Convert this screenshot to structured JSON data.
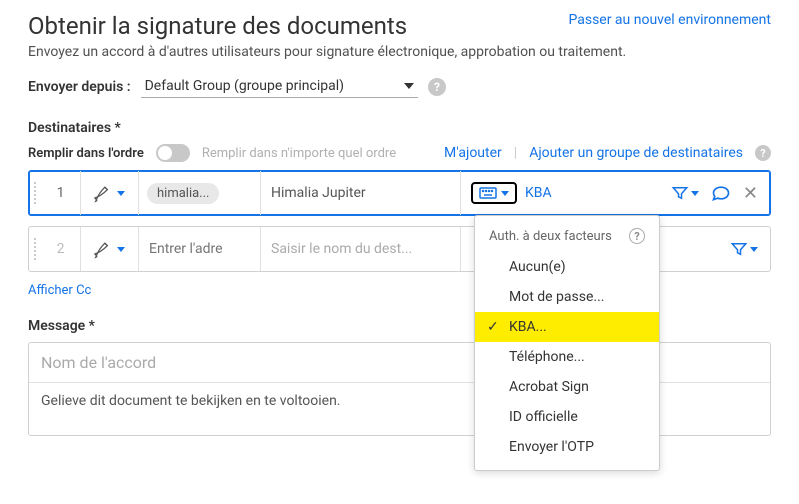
{
  "header": {
    "title": "Obtenir la signature des documents",
    "env_link": "Passer au nouvel environnement",
    "subtitle": "Envoyez un accord à d'autres utilisateurs pour signature électronique, approbation ou traitement."
  },
  "send_from": {
    "label": "Envoyer depuis :",
    "value": "Default Group (groupe principal)"
  },
  "recipients": {
    "section_label": "Destinataires *",
    "order_label": "Remplir dans l'ordre",
    "order_alt": "Remplir dans n'importe quel ordre",
    "add_me": "M'ajouter",
    "add_group": "Ajouter un groupe de destinataires",
    "rows": [
      {
        "num": "1",
        "email_chip": "himalia...",
        "name": "Himalia Jupiter",
        "auth": "KBA"
      },
      {
        "num": "2",
        "email_placeholder": "Entrer l'adre",
        "name_placeholder": "Saisir le nom du dest..."
      }
    ]
  },
  "auth_dropdown": {
    "header": "Auth. à deux facteurs",
    "items": [
      "Aucun(e)",
      "Mot de passe...",
      "KBA...",
      "Téléphone...",
      "Acrobat Sign",
      "ID officielle",
      "Envoyer l'OTP"
    ],
    "selected_index": 2
  },
  "show_cc": "Afficher Cc",
  "message": {
    "label": "Message *",
    "title_placeholder": "Nom de l'accord",
    "body": "Gelieve dit document te bekijken en te voltooien."
  }
}
